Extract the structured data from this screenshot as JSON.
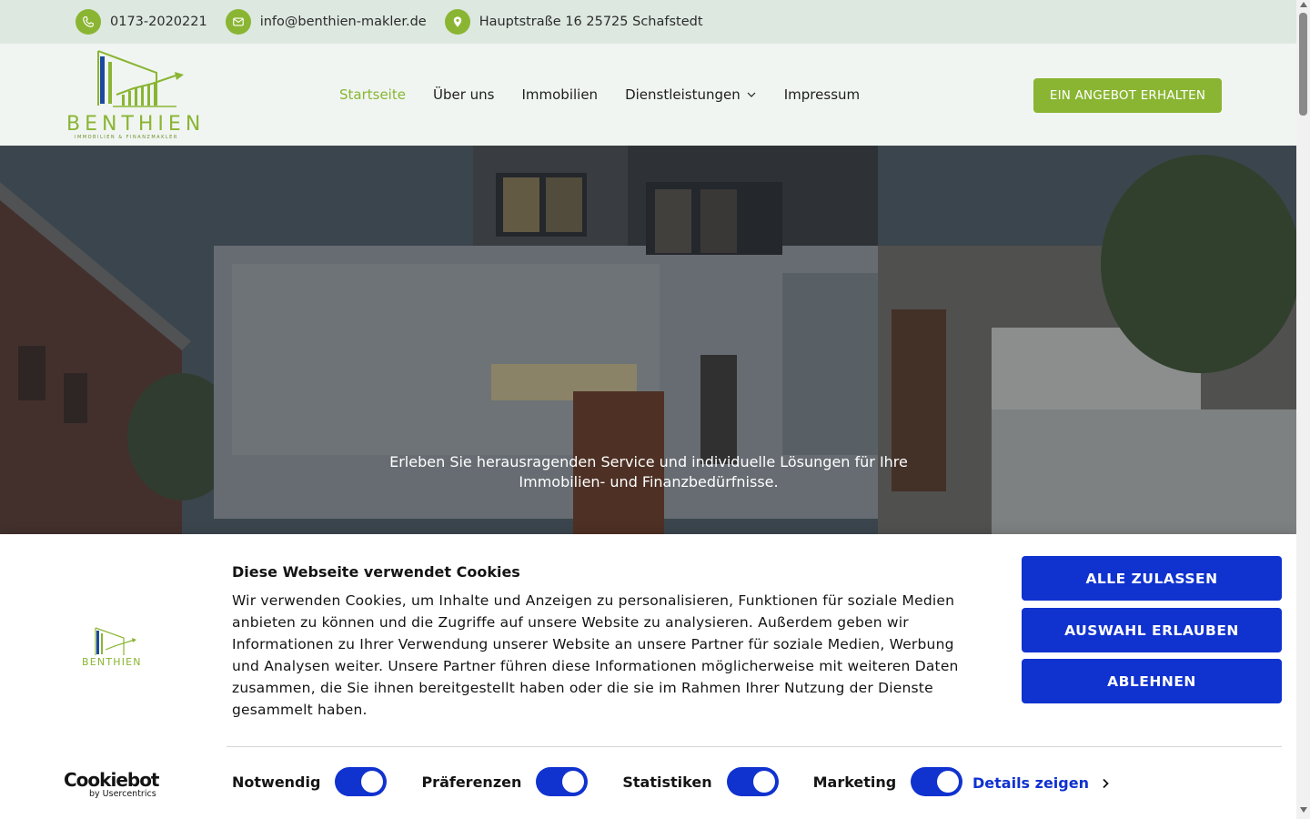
{
  "topbar": {
    "phone": "0173-2020221",
    "email": "info@benthien-makler.de",
    "address": "Hauptstraße 16 25725 Schafstedt"
  },
  "brand": {
    "name": "BENTHIEN",
    "tagline": "IMMOBILIEN & FINANZMAKLER",
    "accent_color": "#8ab533",
    "bar_color": "#1c4aa0"
  },
  "nav": {
    "items": [
      {
        "label": "Startseite",
        "active": true
      },
      {
        "label": "Über uns",
        "active": false
      },
      {
        "label": "Immobilien",
        "active": false
      },
      {
        "label": "Dienstleistungen",
        "active": false,
        "icon": "chevron-down-icon"
      },
      {
        "label": "Impressum",
        "active": false
      }
    ],
    "cta_label": "EIN ANGEBOT ERHALTEN"
  },
  "hero": {
    "text": "Erleben Sie herausragenden Service und individuelle Lösungen für Ihre Immobilien- und Finanzbedürfnisse."
  },
  "cookie": {
    "title": "Diese Webseite verwendet Cookies",
    "body": "Wir verwenden Cookies, um Inhalte und Anzeigen zu personalisieren, Funktionen für soziale Medien anbieten zu können und die Zugriffe auf unsere Website zu analysieren. Außerdem geben wir Informationen zu Ihrer Verwendung unserer Website an unsere Partner für soziale Medien, Werbung und Analysen weiter. Unsere Partner führen diese Informationen möglicherweise mit weiteren Daten zusammen, die Sie ihnen bereitgestellt haben oder die sie im Rahmen Ihrer Nutzung der Dienste gesammelt haben.",
    "buttons": {
      "allow_all": "ALLE ZULASSEN",
      "allow_selection": "AUSWAHL ERLAUBEN",
      "deny": "ABLEHNEN"
    },
    "button_color": "#1032cf",
    "toggles": [
      {
        "label": "Notwendig",
        "on": true
      },
      {
        "label": "Präferenzen",
        "on": true
      },
      {
        "label": "Statistiken",
        "on": true
      },
      {
        "label": "Marketing",
        "on": true
      }
    ],
    "details_label": "Details zeigen",
    "provider_word": "Cookiebot",
    "provider_by": "by Usercentrics"
  }
}
